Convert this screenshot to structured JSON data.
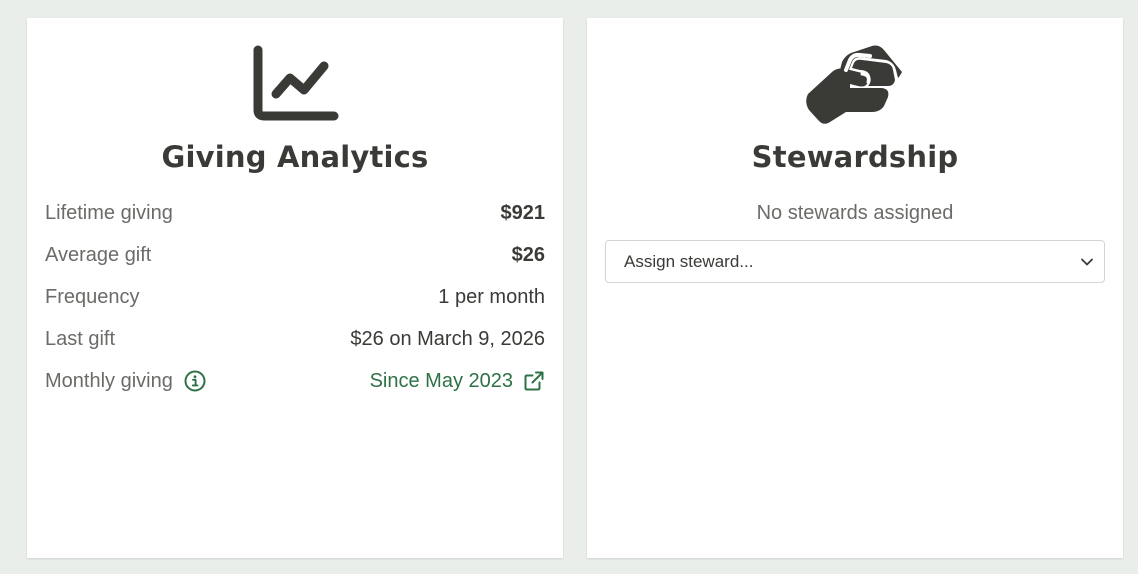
{
  "colors": {
    "page_background": "#e9eeea",
    "card_background": "#ffffff",
    "text_dark": "#3a3a37",
    "text_muted": "#6b6b68",
    "link_green": "#2f7146"
  },
  "giving_analytics": {
    "icon": "line-chart-icon",
    "title": "Giving Analytics",
    "stats": {
      "lifetime_giving": {
        "label": "Lifetime giving",
        "value": "$921"
      },
      "average_gift": {
        "label": "Average gift",
        "value": "$26"
      },
      "frequency": {
        "label": "Frequency",
        "value": "1 per month"
      },
      "last_gift": {
        "label": "Last gift",
        "value": "$26 on March 9, 2026"
      },
      "monthly_giving": {
        "label": "Monthly giving",
        "info_icon": "info-circle-icon",
        "value": "Since May 2023",
        "link_icon": "external-link-icon"
      }
    }
  },
  "stewardship": {
    "icon": "handshake-icon",
    "title": "Stewardship",
    "status": "No stewards assigned",
    "assign_select": {
      "selected": "Assign steward...",
      "icon": "chevron-down-icon"
    }
  }
}
